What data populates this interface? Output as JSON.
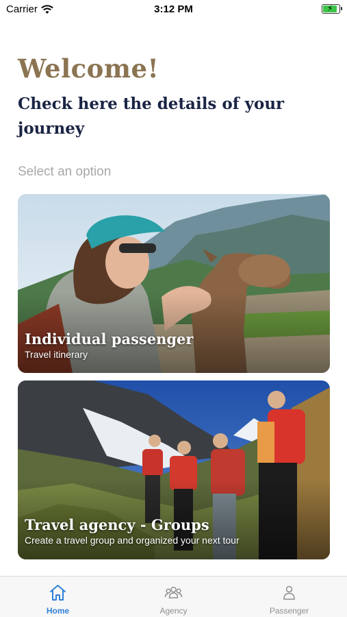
{
  "status_bar": {
    "carrier": "Carrier",
    "time": "3:12 PM",
    "battery_level": 0.8
  },
  "header": {
    "welcome": "Welcome!",
    "subtitle": "Check here the details of your journey",
    "select_label": "Select an option"
  },
  "cards": [
    {
      "title": "Individual passenger",
      "subtitle": "Travel itinerary",
      "image": "woman-with-llama-photo"
    },
    {
      "title": "Travel agency - Groups",
      "subtitle": "Create a travel group and organized your next tour",
      "image": "hikers-in-mountains-photo"
    }
  ],
  "tab_bar": {
    "items": [
      {
        "label": "Home",
        "icon": "home-icon",
        "active": true
      },
      {
        "label": "Agency",
        "icon": "group-icon",
        "active": false
      },
      {
        "label": "Passenger",
        "icon": "person-icon",
        "active": false
      }
    ]
  },
  "colors": {
    "welcome": "#8b7452",
    "heading": "#1a2444",
    "muted": "#a8a8a8",
    "active_tab": "#2e7fd6",
    "inactive_tab": "#8f8f8f"
  }
}
